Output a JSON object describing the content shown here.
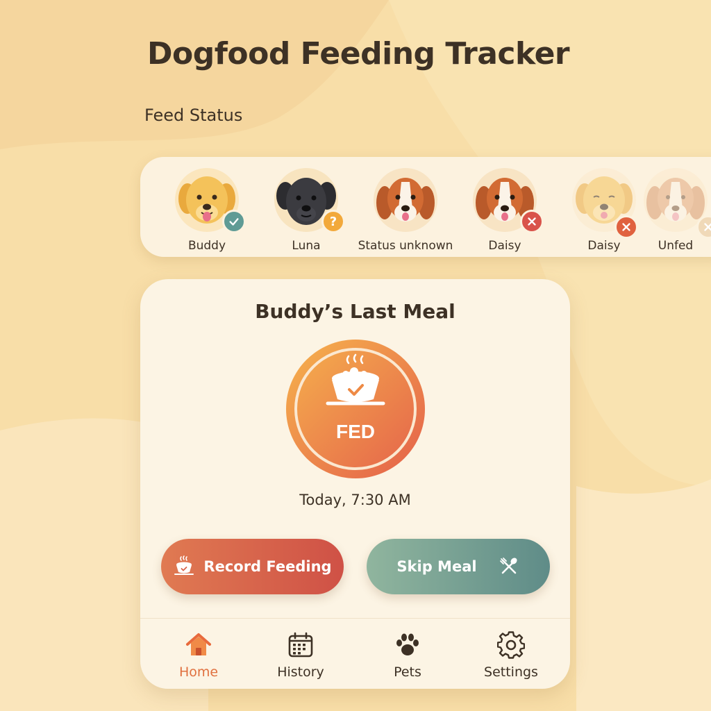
{
  "app": {
    "title": "Dogfood Feeding Tracker",
    "section_label": "Feed Status"
  },
  "dogs": [
    {
      "name": "Buddy",
      "status": "fed",
      "badge_icon": "check-icon",
      "badge_color": "#5f9b95",
      "coat": "golden"
    },
    {
      "name": "Luna",
      "status": "unknown",
      "badge_icon": "question-icon",
      "badge_text": "?",
      "badge_color": "#f2a93b",
      "coat": "black"
    },
    {
      "name": "Status unknown",
      "status": "unknown",
      "badge_icon": "",
      "coat": "beagle"
    },
    {
      "name": "Daisy",
      "status": "unfed",
      "badge_icon": "x-icon",
      "badge_color": "#d9534a",
      "coat": "beagle"
    },
    {
      "name": "Daisy",
      "status": "unfed",
      "badge_icon": "x-icon",
      "badge_color": "#e0623f",
      "coat": "golden-faded"
    },
    {
      "name": "Unfed",
      "status": "unfed",
      "badge_icon": "x-icon",
      "badge_color": "#f0d9b8",
      "coat": "beagle-faded"
    }
  ],
  "last_meal": {
    "title": "Buddy’s Last Meal",
    "status": "FED",
    "status_icon": "food-bowl-check-icon",
    "time": "Today, 7:30 AM"
  },
  "actions": {
    "record_label": "Record Feeding",
    "record_icon": "food-bowl-icon",
    "skip_label": "Skip Meal",
    "skip_icon": "crossed-utensils-icon"
  },
  "nav": [
    {
      "label": "Home",
      "icon": "home-icon",
      "active": true
    },
    {
      "label": "History",
      "icon": "calendar-icon",
      "active": false
    },
    {
      "label": "Pets",
      "icon": "paw-icon",
      "active": false
    },
    {
      "label": "Settings",
      "icon": "gear-icon",
      "active": false
    }
  ],
  "colors": {
    "background": "#f8dea8",
    "panel": "#fcf4e4",
    "accent_orange": "#e0703f",
    "fed_gradient_start": "#f6a94a",
    "fed_gradient_end": "#e4604a",
    "skip_teal": "#5f8c88",
    "text": "#3d3125"
  }
}
